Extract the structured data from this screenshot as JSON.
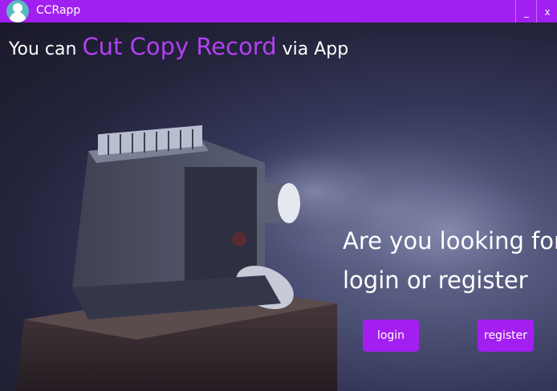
{
  "window": {
    "title": "CCRapp",
    "minimize_label": "_",
    "close_label": "x",
    "accent_color": "#a11ff0"
  },
  "headline": {
    "prefix": "You can",
    "accent": "Cut Copy Record",
    "suffix": "via App",
    "accent_color": "#b340f2"
  },
  "question": {
    "line1": "Are you looking for",
    "line2": "login or register"
  },
  "buttons": {
    "login": "login",
    "register": "register",
    "color": "#a31ff0"
  },
  "icons": {
    "app": "user-avatar-icon",
    "minimize": "minimize-icon",
    "close": "close-icon"
  }
}
